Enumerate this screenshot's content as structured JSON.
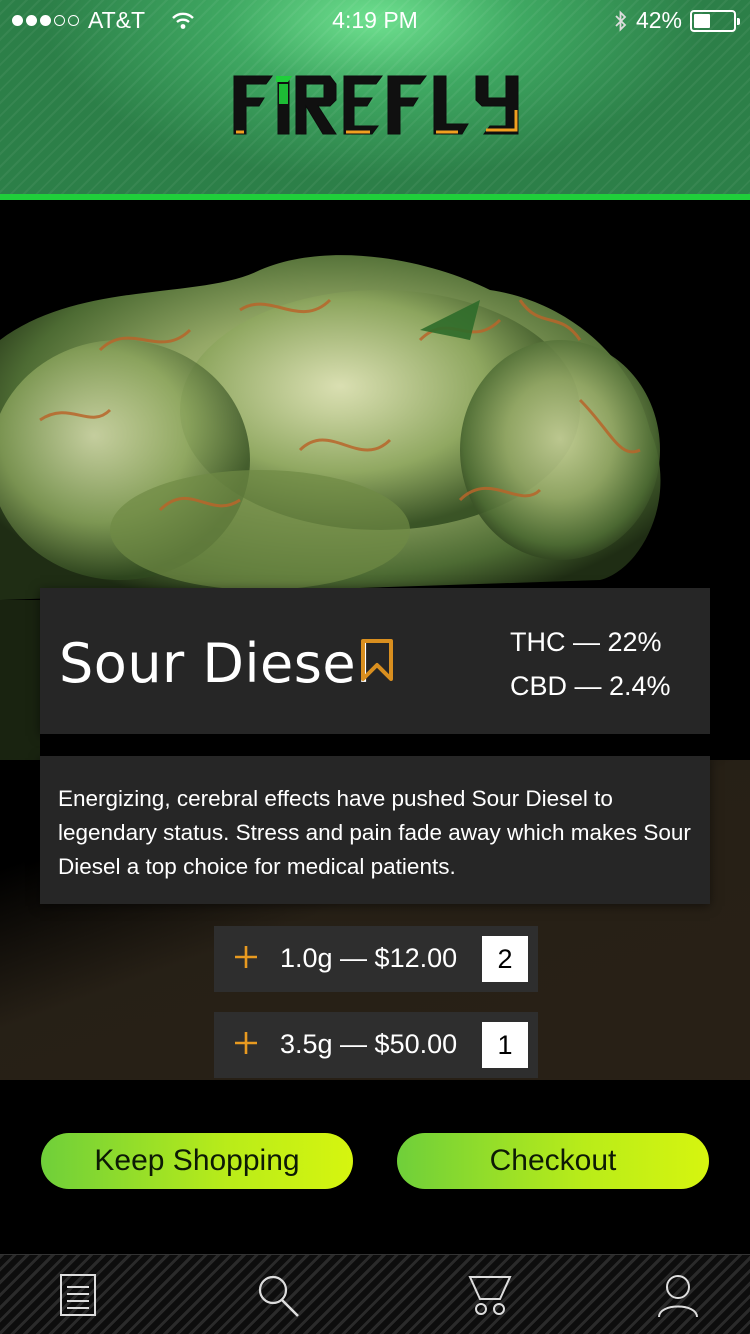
{
  "status_bar": {
    "carrier": "AT&T",
    "time": "4:19 PM",
    "battery": "42%",
    "battery_level": 0.42,
    "signal_bars": 3,
    "signal_total": 5
  },
  "header": {
    "logo_text": "FIREFLY",
    "logo_colors": {
      "primary": "#000000",
      "accent": "#1fcf3a",
      "highlight": "#f0a020"
    }
  },
  "product": {
    "name": "Sour Diesel",
    "thc": "THC — 22%",
    "cbd": "CBD — 2.4%",
    "description": "Energizing, cerebral effects have pushed Sour Diesel to legendary status. Stress and pain fade away which makes Sour Diesel a top choice for medical patients.",
    "bookmark_icon": "bookmark-icon",
    "bookmark_color": "#d98f1f"
  },
  "options": [
    {
      "label": "1.0g — $12.00",
      "quantity": "2",
      "icon": "plus-icon"
    },
    {
      "label": "3.5g — $50.00",
      "quantity": "1",
      "icon": "plus-icon"
    }
  ],
  "actions": {
    "keep_shopping": "Keep Shopping",
    "checkout": "Checkout",
    "button_color": "#b9ec19"
  },
  "tabbar": {
    "items": [
      {
        "icon": "menu-list-icon"
      },
      {
        "icon": "search-icon"
      },
      {
        "icon": "cart-icon"
      },
      {
        "icon": "profile-icon"
      }
    ]
  }
}
